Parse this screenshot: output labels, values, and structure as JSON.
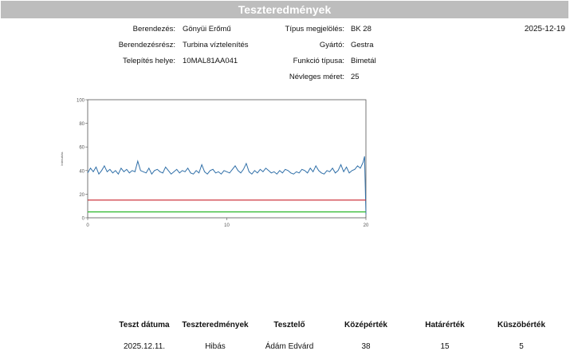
{
  "title": "Teszteredmények",
  "date": "2025-12-19",
  "info": {
    "berendezes_label": "Berendezés:",
    "berendezes_value": "Gönyüi Erőmű",
    "berendezesresz_label": "Berendezésrész:",
    "berendezesresz_value": "Turbina víztelenítés",
    "telepites_label": "Telepítés helye:",
    "telepites_value": "10MAL81AA041",
    "tipus_label": "Típus megjelölés:",
    "tipus_value": "BK 28",
    "gyarto_label": "Gyártó:",
    "gyarto_value": "Gestra",
    "funkcio_label": "Funkció típusa:",
    "funkcio_value": "Bimetál",
    "nevleges_label": "Névleges méret:",
    "nevleges_value": "25"
  },
  "chart_data": {
    "type": "line",
    "ylabel": "Intenzitás",
    "xlim": [
      0,
      20
    ],
    "ylim": [
      0,
      100
    ],
    "xticks": [
      "0",
      "10",
      "20"
    ],
    "yticks": [
      "0",
      "20",
      "40",
      "60",
      "80",
      "100"
    ],
    "series": [
      {
        "role": "measurement",
        "color": "#2f6fa8",
        "x": [
          0,
          0.2,
          0.4,
          0.6,
          0.8,
          1.0,
          1.2,
          1.4,
          1.6,
          1.8,
          2.0,
          2.2,
          2.4,
          2.6,
          2.8,
          3.0,
          3.2,
          3.4,
          3.6,
          3.8,
          4.0,
          4.2,
          4.4,
          4.6,
          4.8,
          5.0,
          5.2,
          5.4,
          5.6,
          5.8,
          6.0,
          6.2,
          6.4,
          6.6,
          6.8,
          7.0,
          7.2,
          7.4,
          7.6,
          7.8,
          8.0,
          8.2,
          8.4,
          8.6,
          8.8,
          9.0,
          9.2,
          9.4,
          9.6,
          9.8,
          10.0,
          10.2,
          10.4,
          10.6,
          10.8,
          11.0,
          11.2,
          11.4,
          11.6,
          11.8,
          12.0,
          12.2,
          12.4,
          12.6,
          12.8,
          13.0,
          13.2,
          13.4,
          13.6,
          13.8,
          14.0,
          14.2,
          14.4,
          14.6,
          14.8,
          15.0,
          15.2,
          15.4,
          15.6,
          15.8,
          16.0,
          16.2,
          16.4,
          16.6,
          16.8,
          17.0,
          17.2,
          17.4,
          17.6,
          17.8,
          18.0,
          18.2,
          18.4,
          18.6,
          18.8,
          19.0,
          19.2,
          19.4,
          19.6,
          19.8,
          19.9,
          20.0
        ],
        "values": [
          38,
          42,
          39,
          43,
          37,
          40,
          44,
          39,
          41,
          38,
          40,
          37,
          42,
          39,
          41,
          38,
          40,
          39,
          48,
          40,
          39,
          38,
          42,
          37,
          40,
          41,
          39,
          38,
          43,
          40,
          37,
          39,
          41,
          38,
          40,
          39,
          42,
          38,
          37,
          40,
          38,
          45,
          39,
          37,
          40,
          41,
          38,
          39,
          37,
          40,
          39,
          38,
          41,
          44,
          40,
          38,
          41,
          46,
          39,
          37,
          40,
          38,
          41,
          39,
          42,
          40,
          38,
          39,
          37,
          40,
          38,
          41,
          40,
          38,
          37,
          39,
          38,
          41,
          40,
          38,
          42,
          39,
          44,
          40,
          38,
          37,
          40,
          39,
          42,
          38,
          40,
          45,
          39,
          43,
          38,
          40,
          41,
          44,
          42,
          47,
          52,
          3
        ]
      },
      {
        "role": "határérték",
        "color": "#c8232b",
        "x": [
          0,
          20
        ],
        "values": [
          15,
          15
        ]
      },
      {
        "role": "küszöbérték",
        "color": "#2eb82e",
        "x": [
          0,
          20
        ],
        "values": [
          5,
          5
        ]
      }
    ]
  },
  "table": {
    "headers": [
      "Teszt dátuma",
      "Teszteredmények",
      "Tesztelő",
      "Középérték",
      "Határérték",
      "Küszöbérték"
    ],
    "row": [
      "2025.12.11.",
      "Hibás",
      "Ádám Edvárd",
      "38",
      "15",
      "5"
    ]
  }
}
